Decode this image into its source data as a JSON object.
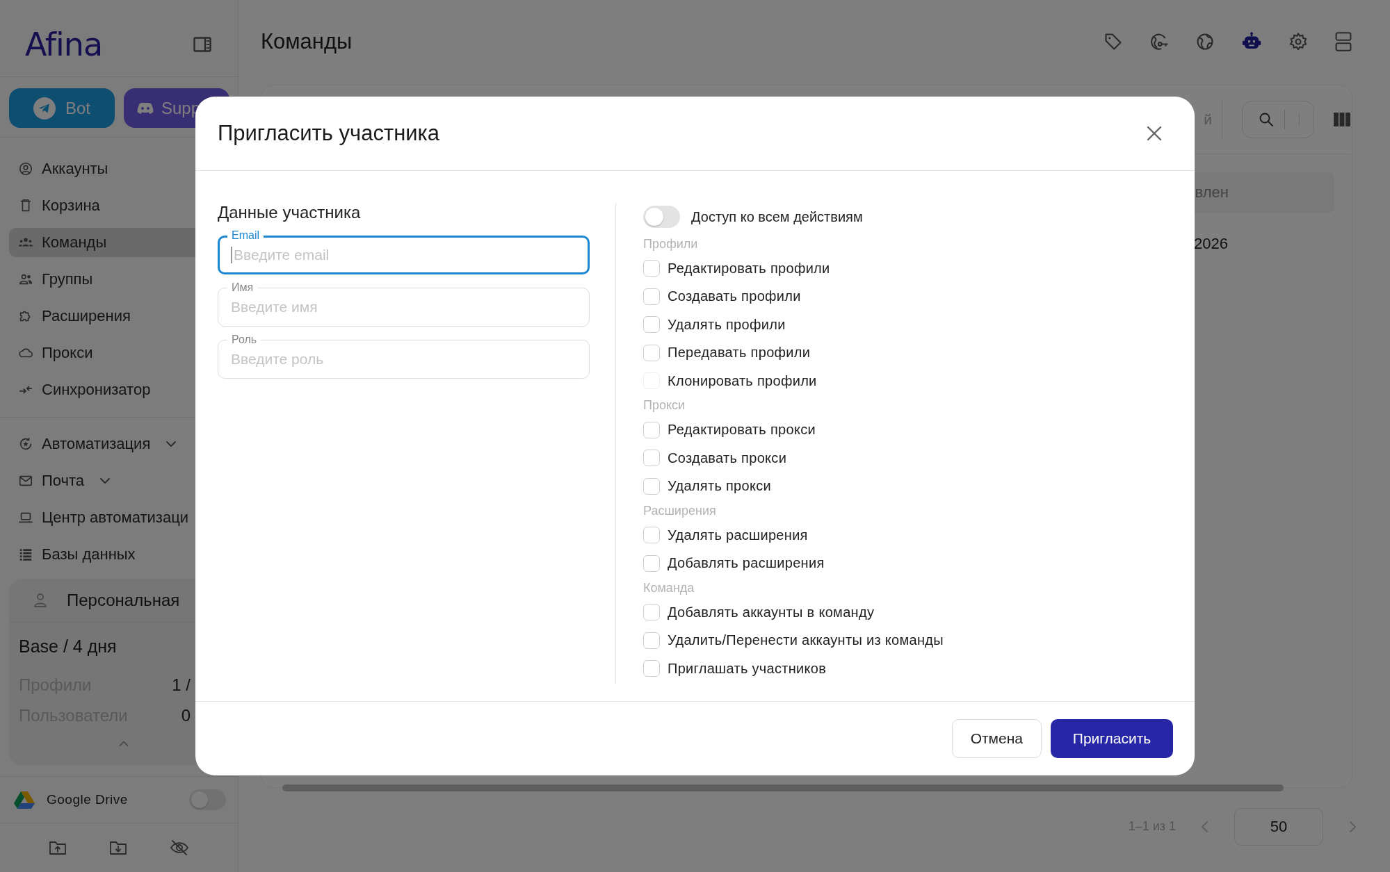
{
  "sidebar": {
    "logo": "Afina",
    "bot_button": "Bot",
    "support_button": "Supp",
    "nav": [
      {
        "label": "Аккаунты",
        "selected": false
      },
      {
        "label": "Корзина",
        "selected": false
      },
      {
        "label": "Команды",
        "selected": true
      },
      {
        "label": "Группы",
        "selected": false
      },
      {
        "label": "Расширения",
        "selected": false
      },
      {
        "label": "Прокси",
        "selected": false
      },
      {
        "label": "Синхронизатор",
        "selected": false
      }
    ],
    "nav_secondary": [
      {
        "label": "Автоматизация",
        "expandable": true
      },
      {
        "label": "Почта",
        "expandable": true
      },
      {
        "label": "Центр автоматизаци",
        "expandable": false
      },
      {
        "label": "Базы данных",
        "expandable": false
      }
    ],
    "plan": {
      "title": "Персональная",
      "tariff": "Base / 4 дня",
      "rows": [
        {
          "label": "Профили",
          "value": "1 /"
        },
        {
          "label": "Пользователи",
          "value": "0"
        }
      ]
    },
    "google_drive": {
      "label": "Google Drive",
      "on": false
    }
  },
  "header": {
    "title": "Команды"
  },
  "toolbar": {
    "fragment": "й"
  },
  "table": {
    "column_fragment": "влен",
    "cell_fragment": "2026"
  },
  "pagination": {
    "range": "1–1 из 1",
    "page_size": "50"
  },
  "dialog": {
    "title": "Пригласить участника",
    "section_title": "Данные участника",
    "fields": [
      {
        "label": "Email",
        "placeholder": "Введите email",
        "focused": true
      },
      {
        "label": "Имя",
        "placeholder": "Введите имя",
        "focused": false
      },
      {
        "label": "Роль",
        "placeholder": "Введите роль",
        "focused": false
      }
    ],
    "all_access": {
      "label": "Доступ ко всем действиям",
      "on": false
    },
    "groups": [
      {
        "title": "Профили",
        "items": [
          {
            "label": "Редактировать профили",
            "checked": false,
            "disabled": false
          },
          {
            "label": "Создавать профили",
            "checked": false,
            "disabled": false
          },
          {
            "label": "Удалять профили",
            "checked": false,
            "disabled": false
          },
          {
            "label": "Передавать профили",
            "checked": false,
            "disabled": false
          },
          {
            "label": "Клонировать профили",
            "checked": false,
            "disabled": true
          }
        ]
      },
      {
        "title": "Прокси",
        "items": [
          {
            "label": "Редактировать прокси",
            "checked": false,
            "disabled": false
          },
          {
            "label": "Создавать прокси",
            "checked": false,
            "disabled": false
          },
          {
            "label": "Удалять прокси",
            "checked": false,
            "disabled": false
          }
        ]
      },
      {
        "title": "Расширения",
        "items": [
          {
            "label": "Удалять расширения",
            "checked": false,
            "disabled": false
          },
          {
            "label": "Добавлять расширения",
            "checked": false,
            "disabled": false
          }
        ]
      },
      {
        "title": "Команда",
        "items": [
          {
            "label": "Добавлять аккаунты в команду",
            "checked": false,
            "disabled": false
          },
          {
            "label": "Удалить/Перенести аккаунты из команды",
            "checked": false,
            "disabled": false
          },
          {
            "label": "Приглашать участников",
            "checked": false,
            "disabled": false
          }
        ]
      }
    ],
    "cancel_button": "Отмена",
    "submit_button": "Пригласить"
  }
}
